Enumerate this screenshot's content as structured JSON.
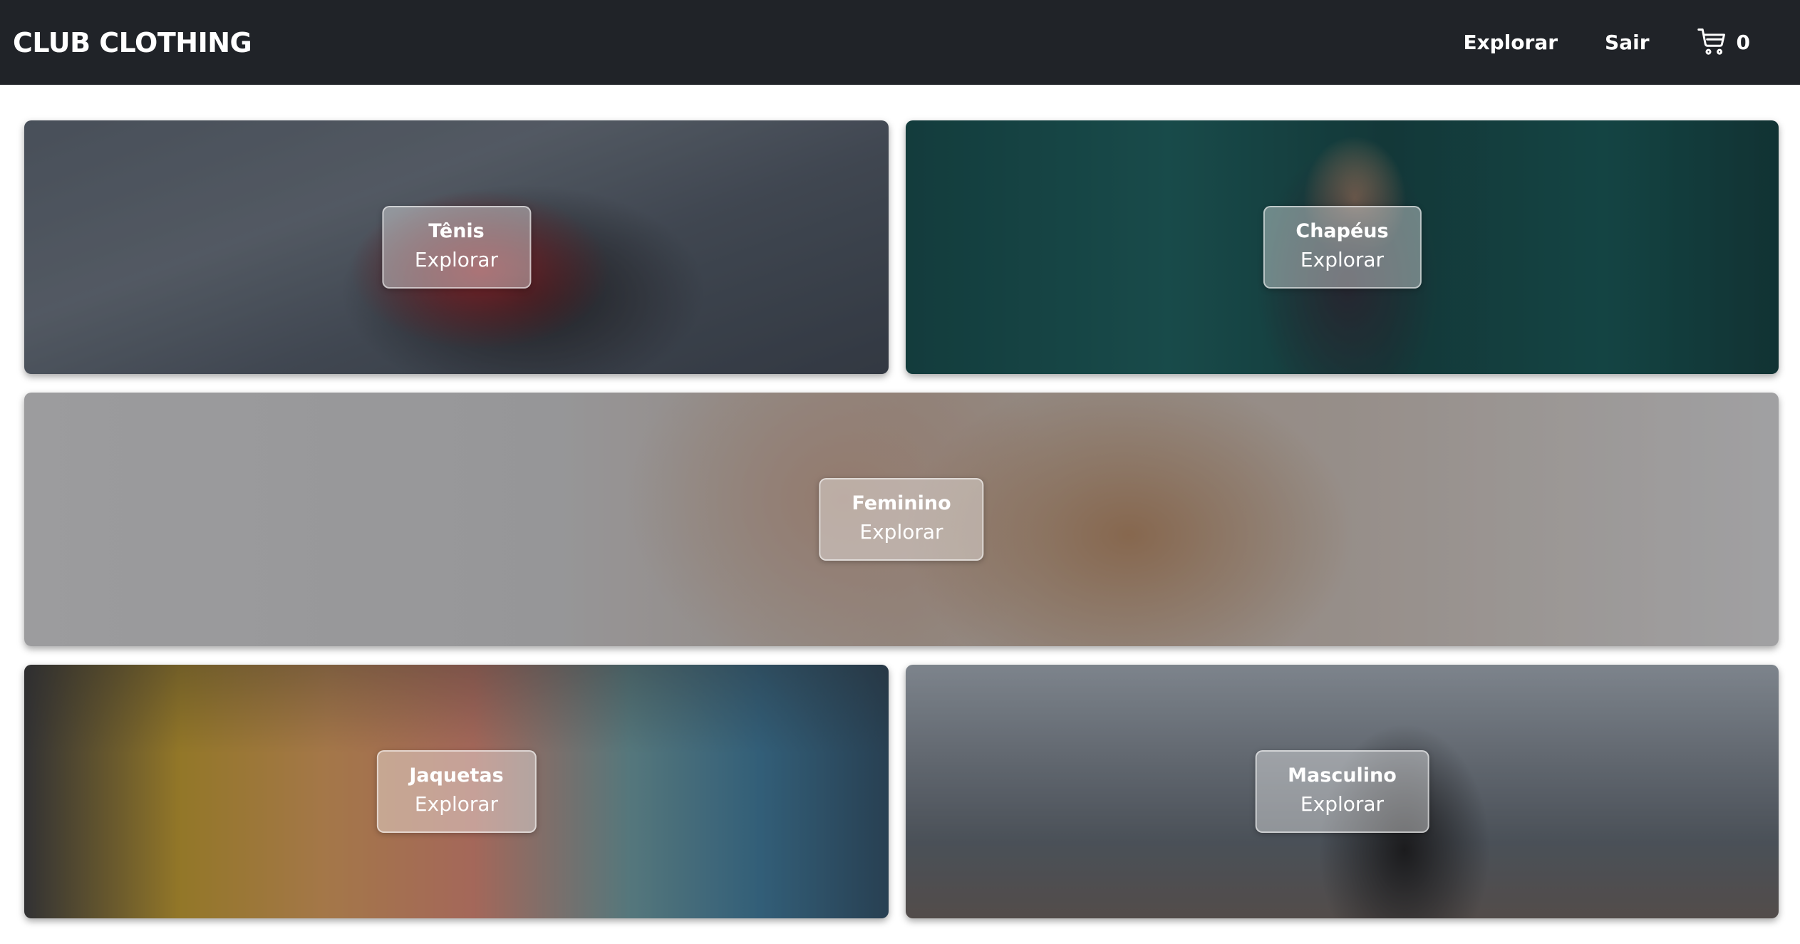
{
  "navbar": {
    "brand": "CLUB CLOTHING",
    "links": {
      "explore": "Explorar",
      "logout": "Sair"
    },
    "cart_count": "0"
  },
  "categories": [
    {
      "title": "Tênis",
      "action": "Explorar"
    },
    {
      "title": "Chapéus",
      "action": "Explorar"
    },
    {
      "title": "Feminino",
      "action": "Explorar"
    },
    {
      "title": "Jaquetas",
      "action": "Explorar"
    },
    {
      "title": "Masculino",
      "action": "Explorar"
    }
  ],
  "colors": {
    "navbar_bg": "#202328",
    "nav_text": "#ffffff",
    "label_overlay": "rgba(255,255,255,0.38)"
  }
}
